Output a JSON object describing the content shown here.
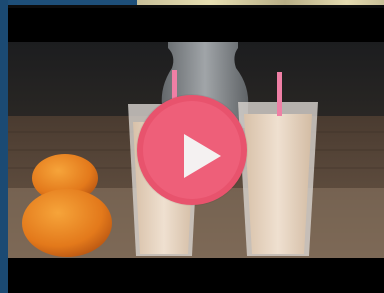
{
  "player": {
    "play_icon": "play-icon",
    "colors": {
      "play_button": "#e8536d",
      "play_button_inner": "#ee5f79",
      "play_glyph": "#f4f1f1",
      "sidebar_accent": "#1b4a73"
    }
  }
}
